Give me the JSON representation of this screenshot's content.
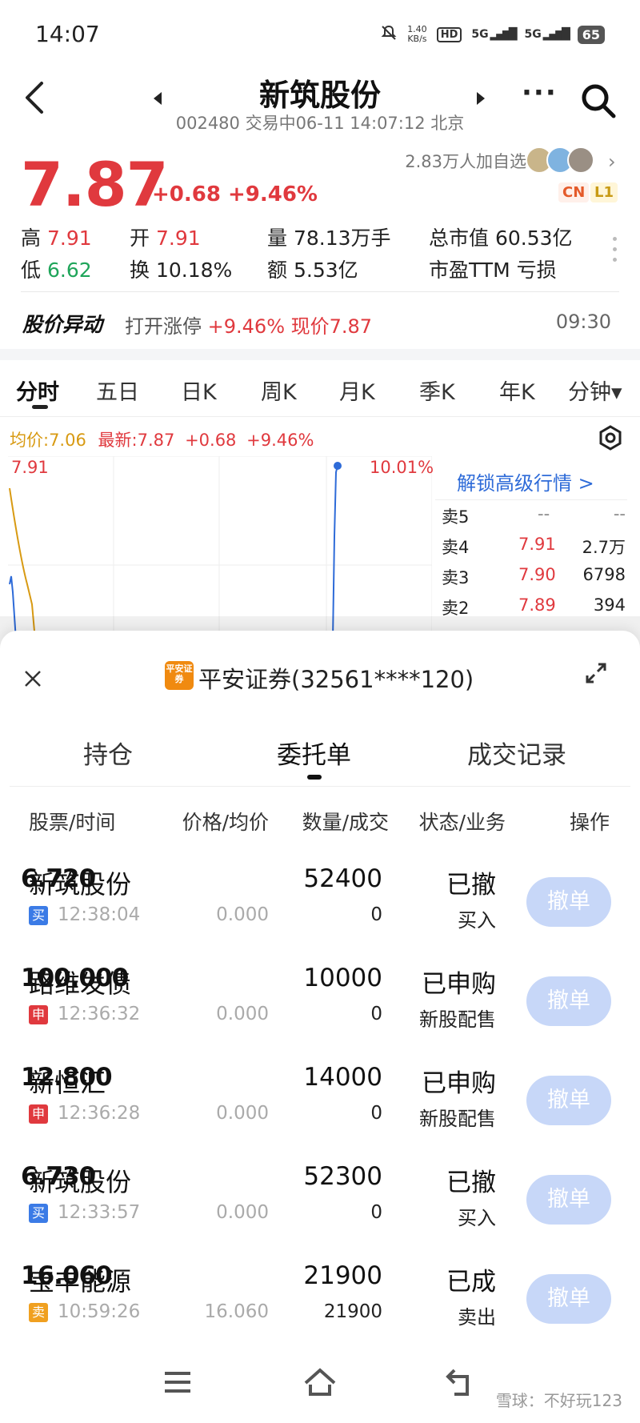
{
  "status_bar": {
    "time": "14:07",
    "net_speed_top": "1.40",
    "net_speed_bottom": "KB/s",
    "hd": "HD",
    "sig1": "5G",
    "sig2": "5G",
    "battery": "65"
  },
  "header": {
    "title": "新筑股份",
    "subtitle": "002480 交易中06-11 14:07:12 北京",
    "more_label": "···"
  },
  "quote": {
    "price": "7.87",
    "change": "+0.68 +9.46%",
    "watchers": "2.83万人加自选",
    "badge_cn": "CN",
    "badge_l1": "L1",
    "stats": [
      {
        "label": "高",
        "value": "7.91"
      },
      {
        "label": "开",
        "value": "7.91"
      },
      {
        "label": "量",
        "value": "78.13万手"
      },
      {
        "label": "总市值",
        "value": "60.53亿"
      },
      {
        "label": "低",
        "value": "6.62"
      },
      {
        "label": "换",
        "value": "10.18%"
      },
      {
        "label": "额",
        "value": "5.53亿"
      },
      {
        "label": "市盈TTM",
        "value": "亏损"
      }
    ]
  },
  "alert": {
    "title": "股价异动",
    "text_prefix": "打开涨停",
    "text_values": "+9.46% 现价7.87",
    "time": "09:30"
  },
  "chart_tabs": [
    "分时",
    "五日",
    "日K",
    "周K",
    "月K",
    "季K",
    "年K",
    "分钟▾"
  ],
  "chart_legend": {
    "avg": "均价:7.06",
    "latest": "最新:7.87",
    "change": "+0.68",
    "pct": "+9.46%"
  },
  "chart": {
    "y_top_label": "7.91",
    "pct_top_label": "10.01%"
  },
  "order_book": {
    "unlock_label": "解锁高级行情 >",
    "rows": [
      {
        "side": "卖5",
        "price": "--",
        "vol": "--"
      },
      {
        "side": "卖4",
        "price": "7.91",
        "vol": "2.7万"
      },
      {
        "side": "卖3",
        "price": "7.90",
        "vol": "6798"
      },
      {
        "side": "卖2",
        "price": "7.89",
        "vol": "394"
      }
    ]
  },
  "sheet": {
    "broker_logo_text": "平安证券",
    "broker": "平安证券(32561****120)",
    "tabs": [
      "持仓",
      "委托单",
      "成交记录"
    ],
    "columns": [
      "股票/时间",
      "价格/均价",
      "数量/成交",
      "状态/业务",
      "操作"
    ],
    "orders": [
      {
        "name": "新筑股份",
        "tag": "买",
        "tag_type": "buy",
        "time": "12:38:04",
        "price": "6.720",
        "avg": "0.000",
        "qty": "52400",
        "filled": "0",
        "status": "已撤",
        "biz": "买入",
        "action": "撤单"
      },
      {
        "name": "路维发债",
        "tag": "申",
        "tag_type": "ipo",
        "time": "12:36:32",
        "price": "100.000",
        "avg": "0.000",
        "qty": "10000",
        "filled": "0",
        "status": "已申购",
        "biz": "新股配售",
        "action": "撤单"
      },
      {
        "name": "新恒汇",
        "tag": "申",
        "tag_type": "ipo",
        "time": "12:36:28",
        "price": "12.800",
        "avg": "0.000",
        "qty": "14000",
        "filled": "0",
        "status": "已申购",
        "biz": "新股配售",
        "action": "撤单"
      },
      {
        "name": "新筑股份",
        "tag": "买",
        "tag_type": "buy",
        "time": "12:33:57",
        "price": "6.730",
        "avg": "0.000",
        "qty": "52300",
        "filled": "0",
        "status": "已撤",
        "biz": "买入",
        "action": "撤单"
      },
      {
        "name": "宝丰能源",
        "tag": "卖",
        "tag_type": "sell",
        "time": "10:59:26",
        "price": "16.060",
        "avg": "16.060",
        "qty": "21900",
        "filled": "21900",
        "status": "已成",
        "biz": "卖出",
        "action": "撤单"
      }
    ]
  },
  "watermark": "雪球：不好玩123",
  "colors": {
    "up": "#e0393e",
    "down": "#1fa55a",
    "link": "#2e6bd8",
    "avg_line": "#d89a12",
    "cancel_btn": "#c7d7f8"
  }
}
